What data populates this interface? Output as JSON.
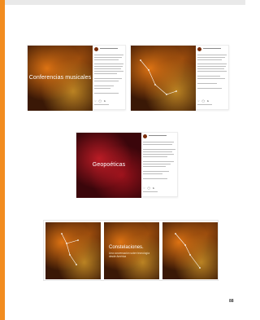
{
  "page": {
    "number": "88"
  },
  "posts": {
    "first": {
      "image_title": "Conferencias musicales"
    },
    "second": {
      "image_title": ""
    },
    "third": {
      "image_title": "Geopoéticas"
    }
  },
  "grid": {
    "center_title": "Constelaciones.",
    "center_subtitle": "Una conversación sobre tecnología desde América"
  },
  "colors": {
    "accent": "#f28c1f",
    "nebula_orange": "#c86b12",
    "nebula_red": "#8b0f1a"
  },
  "icons": [
    "heart-icon",
    "comment-icon",
    "share-icon",
    "bookmark-icon"
  ]
}
